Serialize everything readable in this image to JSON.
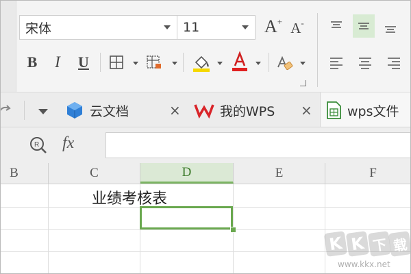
{
  "app": "WPS Spreadsheets",
  "ribbon": {
    "font_name": "宋体",
    "font_size": "11",
    "grow_font_label": "A",
    "grow_font_sup": "+",
    "shrink_font_label": "A",
    "shrink_font_sup": "-",
    "bold_label": "B",
    "italic_label": "I",
    "underline_label": "U",
    "alignment_active": "center"
  },
  "tabs": [
    {
      "label": "云文档",
      "icon": "cloud-cube-icon",
      "closable": true
    },
    {
      "label": "我的WPS",
      "icon": "wps-logo-icon",
      "closable": true
    },
    {
      "label": "wps文件",
      "icon": "spreadsheet-doc-icon",
      "active": true
    }
  ],
  "tab_close_glyph": "×",
  "formula_bar": {
    "fx_label": "fx",
    "formula_value": ""
  },
  "grid": {
    "columns": [
      "B",
      "C",
      "D",
      "E",
      "F"
    ],
    "active_column": "D",
    "cells": [
      {
        "ref": "C1",
        "value": "业绩考核表"
      }
    ],
    "selected_cell": "D2"
  },
  "watermark": {
    "chars": [
      "K",
      "K",
      "下",
      "载"
    ],
    "url": "www.kkx.net"
  },
  "colors": {
    "accent_green": "#6aa84f",
    "active_header_bg": "#dbe9d5",
    "fill_yellow": "#f5d800",
    "font_red": "#e02020",
    "wps_red": "#d9252a",
    "cloud_blue": "#2f7fd6"
  }
}
